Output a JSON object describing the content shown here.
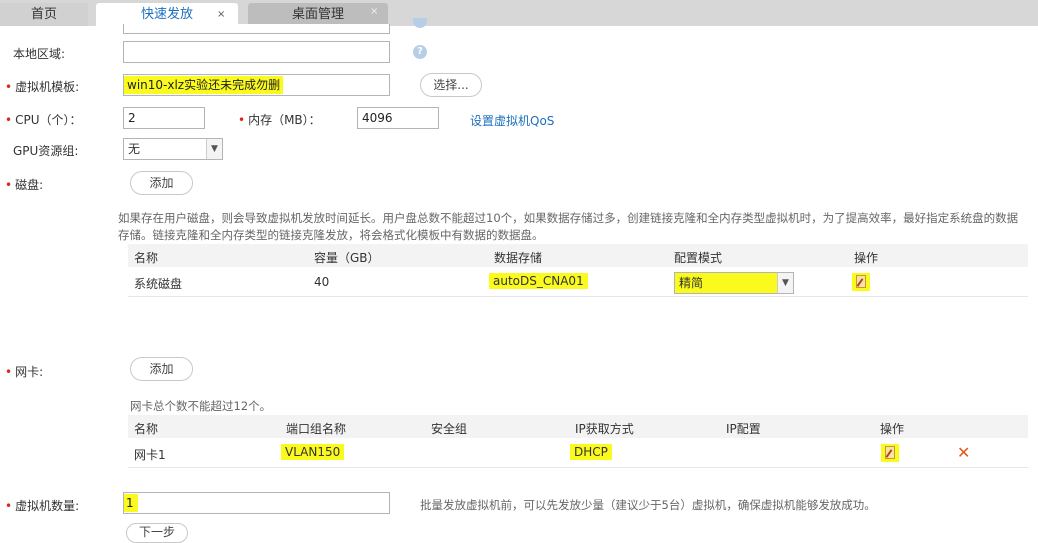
{
  "tabs": [
    {
      "label": "首页"
    },
    {
      "label": "快速发放",
      "close": "×"
    },
    {
      "label": "桌面管理",
      "close": "×"
    }
  ],
  "icons": {
    "help": "question-circle-icon",
    "edit": "edit-doc-icon",
    "delete": "x-delete-icon",
    "dropdown": "chevron-down-icon"
  },
  "form": {
    "local_area": {
      "label": "本地区域:",
      "value": ""
    },
    "vm_template": {
      "label": "虚拟机模板:",
      "value": "win10-xlz实验还未完成勿删",
      "select_button": "选择..."
    },
    "cpu": {
      "label": "CPU（个）：",
      "value": "2"
    },
    "memory": {
      "label": "内存（MB）：",
      "value": "4096"
    },
    "qos_link": "设置虚拟机QoS",
    "gpu_group": {
      "label": "GPU资源组:",
      "value": "无"
    },
    "disk": {
      "label": "磁盘:",
      "add_button": "添加",
      "note": "如果存在用户磁盘，则会导致虚拟机发放时间延长。用户盘总数不能超过10个，如果数据存储过多，创建链接克隆和全内存类型虚拟机时，为了提高效率，最好指定系统盘的数据存储。链接克隆和全内存类型的链接克隆发放，将会格式化模板中有数据的数据盘。",
      "columns": [
        "名称",
        "容量（GB）",
        "数据存储",
        "配置模式",
        "操作"
      ],
      "rows": [
        {
          "name": "系统磁盘",
          "capacity": "40",
          "datastore": "autoDS_CNA01",
          "mode": "精简"
        }
      ]
    },
    "nic": {
      "label": "网卡:",
      "add_button": "添加",
      "note": "网卡总个数不能超过12个。",
      "columns": [
        "名称",
        "端口组名称",
        "安全组",
        "IP获取方式",
        "IP配置",
        "操作"
      ],
      "rows": [
        {
          "name": "网卡1",
          "port_group": "VLAN150",
          "security_group": "",
          "ip_mode": "DHCP",
          "ip_config": ""
        }
      ]
    },
    "vm_count": {
      "label": "虚拟机数量:",
      "value": "1",
      "hint": "批量发放虚拟机前，可以先发放少量（建议少于5台）虚拟机，确保虚拟机能够发放成功。"
    },
    "next_button": "下一步"
  },
  "colors": {
    "required": "#e2231a",
    "link": "#1c6fbd",
    "highlight": "#fafa1e",
    "delete": "#e05a1c"
  }
}
